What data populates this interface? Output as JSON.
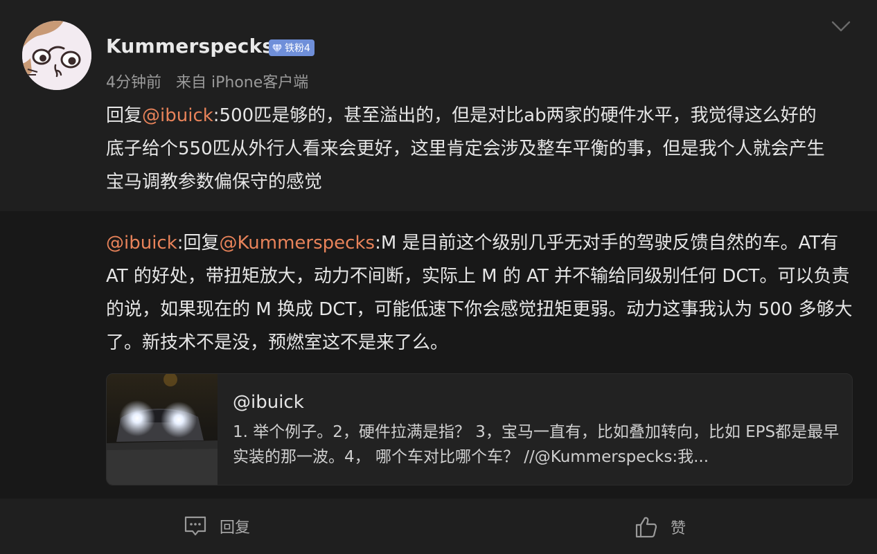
{
  "post": {
    "username": "Kummerspecks",
    "badge": "铁粉4",
    "time": "4分钟前",
    "source": "来自 iPhone客户端",
    "reply_prefix": "回复",
    "reply_mention": "@ibuick",
    "reply_body": ":500匹是够的，甚至溢出的，但是对比ab两家的硬件水平，我觉得这么好的底子给个550匹从外行人看来会更好，这里肯定会涉及整车平衡的事，但是我个人就会产生宝马调教参数偏保守的感觉"
  },
  "quote": {
    "mention1": "@ibuick",
    "mid": ":回复",
    "mention2": "@Kummerspecks",
    "body": ":M 是目前这个级别几乎无对手的驾驶反馈自然的车。AT有 AT 的好处，带扭矩放大，动力不间断，实际上 M 的 AT 并不输给同级别任何 DCT。可以负责的说，如果现在的 M 换成 DCT，可能低速下你会感觉扭矩更弱。动力这事我认为 500 多够大了。新技术不是没，预燃室这不是来了么。"
  },
  "card": {
    "title": "@ibuick",
    "body": "1. 举个例子。2，硬件拉满是指？ 3，宝马一直有，比如叠加转向，比如 EPS都是最早实装的那一波。4， 哪个车对比哪个车？ //@Kummerspecks:我..."
  },
  "actions": {
    "reply_label": "回复",
    "like_label": "赞"
  },
  "icons": {
    "avatar": "cat-avatar",
    "collapse": "chevron-down-icon",
    "badge": "diamond-icon",
    "reply": "comment-icon",
    "like": "thumbs-up-icon"
  },
  "colors": {
    "mention": "#e8835a",
    "badge_bg": "#6f8fd9",
    "background": "#1f1f1f"
  }
}
